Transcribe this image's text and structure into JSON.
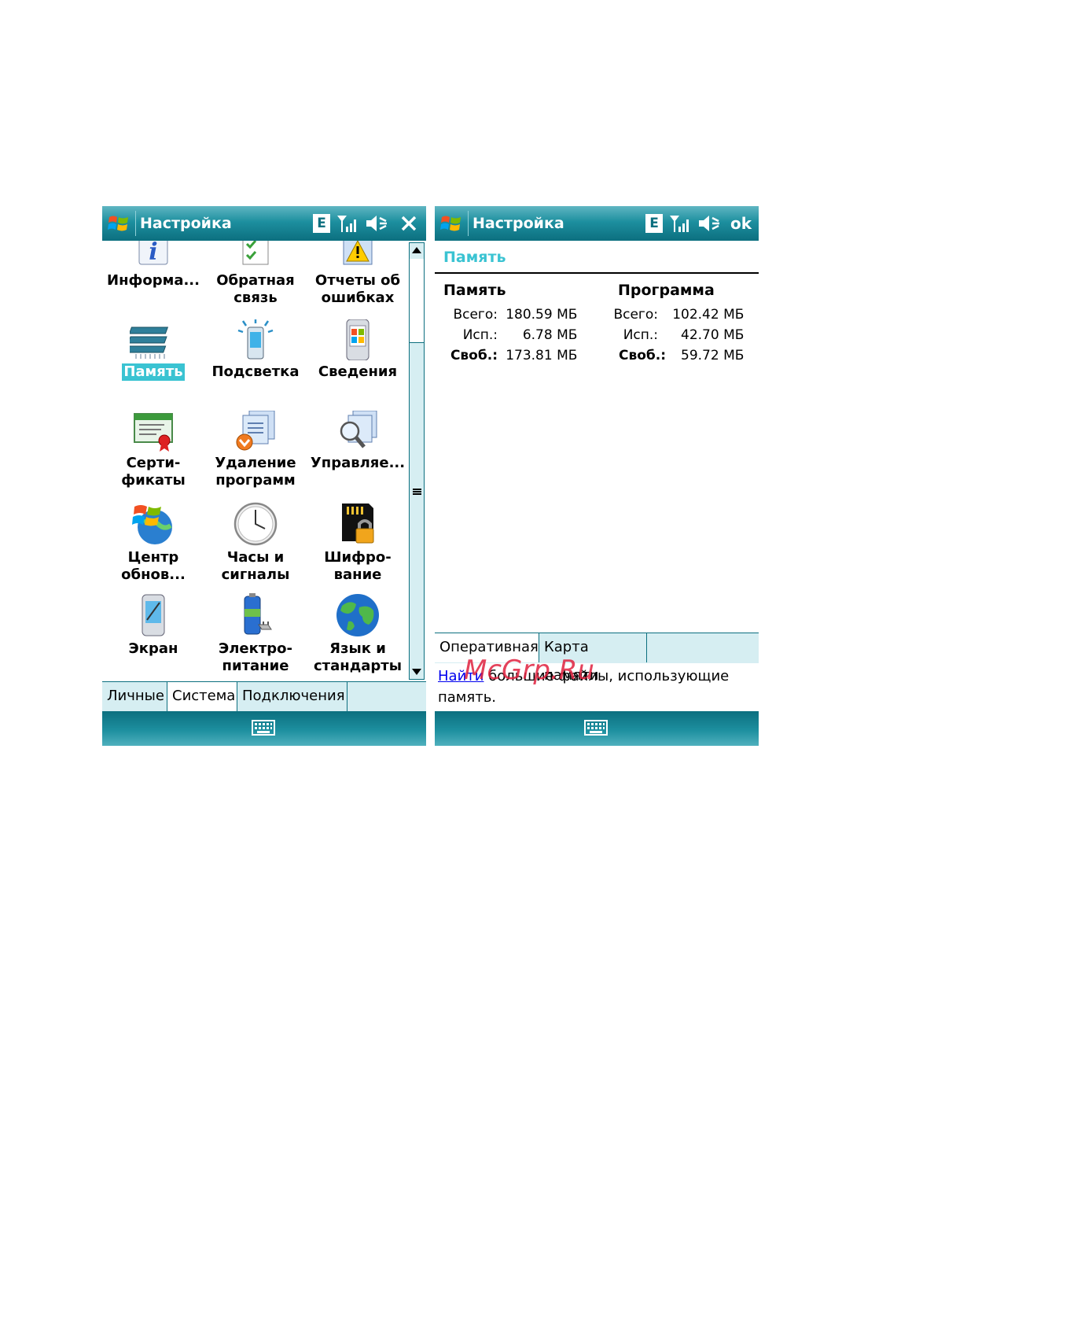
{
  "left": {
    "title": "Настройка",
    "status_e": "E",
    "icons": [
      {
        "label": "Информа...",
        "icon": "info-icon"
      },
      {
        "label": "Обратная\nсвязь",
        "icon": "feedback-icon"
      },
      {
        "label": "Отчеты об\nошибках",
        "icon": "error-report-icon"
      },
      {
        "label": "Память",
        "icon": "memory-icon",
        "selected": true
      },
      {
        "label": "Подсветка",
        "icon": "backlight-icon"
      },
      {
        "label": "Сведения",
        "icon": "about-icon"
      },
      {
        "label": "Серти-\nфикаты",
        "icon": "certificates-icon"
      },
      {
        "label": "Удаление\nпрограмм",
        "icon": "remove-programs-icon"
      },
      {
        "label": "Управляе...",
        "icon": "managed-programs-icon"
      },
      {
        "label": "Центр\nобнов...",
        "icon": "update-center-icon"
      },
      {
        "label": "Часы и\nсигналы",
        "icon": "clock-icon"
      },
      {
        "label": "Шифро-\nвание",
        "icon": "encryption-icon"
      },
      {
        "label": "Экран",
        "icon": "screen-icon"
      },
      {
        "label": "Электро-\nпитание",
        "icon": "power-icon"
      },
      {
        "label": "Язык и\nстандарты",
        "icon": "language-icon"
      }
    ],
    "tabs": [
      "Личные",
      "Система",
      "Подключения"
    ],
    "active_tab": 1
  },
  "right": {
    "title": "Настройка",
    "status_e": "E",
    "ok_label": "ok",
    "heading": "Память",
    "col1": {
      "title": "Память",
      "total_label": "Всего:",
      "total": "180.59 МБ",
      "used_label": "Исп.:",
      "used": "6.78 МБ",
      "free_label": "Своб.:",
      "free": "173.81 МБ"
    },
    "col2": {
      "title": "Программа",
      "total_label": "Всего:",
      "total": "102.42 МБ",
      "used_label": "Исп.:",
      "used": "42.70 МБ",
      "free_label": "Своб.:",
      "free": "59.72 МБ"
    },
    "tabs": [
      "Оперативная",
      "Карта памяти"
    ],
    "active_tab": 0,
    "link_text": "Найти",
    "link_rest": " большие файлы, использующие память."
  },
  "watermark": "McGrp.Ru",
  "colors": {
    "accent": "#3ac3d2",
    "bar_dark": "#0c6f7f",
    "tab_bg": "#d6eef2"
  }
}
